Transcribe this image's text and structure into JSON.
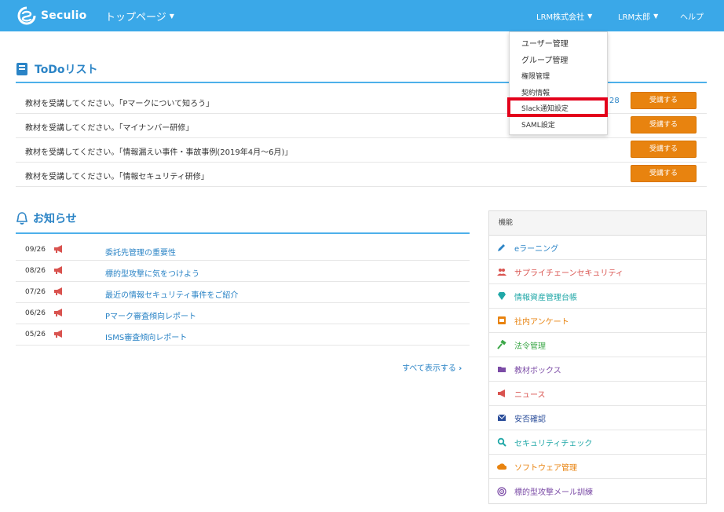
{
  "header": {
    "brand": "Seculio",
    "page_menu": "トップページ",
    "company_menu": "LRM株式会社",
    "user_menu": "LRM太郎",
    "help": "ヘルプ"
  },
  "dropdown": {
    "items": [
      "ユーザー管理",
      "グループ管理",
      "権限管理",
      "契約情報",
      "Slack通知設定",
      "SAML設定"
    ]
  },
  "todo": {
    "title": "ToDoリスト",
    "rows": [
      {
        "text": "教材を受講してください。「Pマークについて知ろう」",
        "date": "28",
        "button": "受講する"
      },
      {
        "text": "教材を受講してください。「マイナンバー研修」",
        "button": "受講する"
      },
      {
        "text": "教材を受講してください。「情報漏えい事件・事故事例(2019年4月～6月)」",
        "button": "受講する"
      },
      {
        "text": "教材を受講してください。「情報セキュリティ研修」",
        "button": "受講する"
      }
    ]
  },
  "news": {
    "title": "お知らせ",
    "rows": [
      {
        "date": "09/26",
        "title": "委託先管理の重要性"
      },
      {
        "date": "08/26",
        "title": "標的型攻撃に気をつけよう"
      },
      {
        "date": "07/26",
        "title": "最近の情報セキュリティ事件をご紹介"
      },
      {
        "date": "06/26",
        "title": "Pマーク審査傾向レポート"
      },
      {
        "date": "05/26",
        "title": "ISMS審査傾向レポート"
      }
    ],
    "show_all": "すべて表示する"
  },
  "panel": {
    "title": "機能",
    "items": [
      {
        "label": "eラーニング",
        "icon": "pencil-icon",
        "color": "#2b84c6"
      },
      {
        "label": "サプライチェーンセキュリティ",
        "icon": "users-icon",
        "color": "#d9534f"
      },
      {
        "label": "情報資産管理台帳",
        "icon": "diamond-icon",
        "color": "#1fa7a7"
      },
      {
        "label": "社内アンケート",
        "icon": "survey-icon",
        "color": "#e8830f"
      },
      {
        "label": "法令管理",
        "icon": "gavel-icon",
        "color": "#3ea84a"
      },
      {
        "label": "教材ボックス",
        "icon": "folder-icon",
        "color": "#7b4ba6"
      },
      {
        "label": "ニュース",
        "icon": "megaphone-icon",
        "color": "#d9534f"
      },
      {
        "label": "安否確認",
        "icon": "envelope-icon",
        "color": "#2a4d9a"
      },
      {
        "label": "セキュリティチェック",
        "icon": "search-icon",
        "color": "#1fa7a7"
      },
      {
        "label": "ソフトウェア管理",
        "icon": "cloud-icon",
        "color": "#e8830f"
      },
      {
        "label": "標的型攻撃メール訓練",
        "icon": "target-icon",
        "color": "#7b4ba6"
      }
    ]
  },
  "colors": {
    "navbar": "#3aa8e8",
    "accent": "#2b84c6",
    "button": "#e8830f",
    "highlight": "#e3001b"
  }
}
